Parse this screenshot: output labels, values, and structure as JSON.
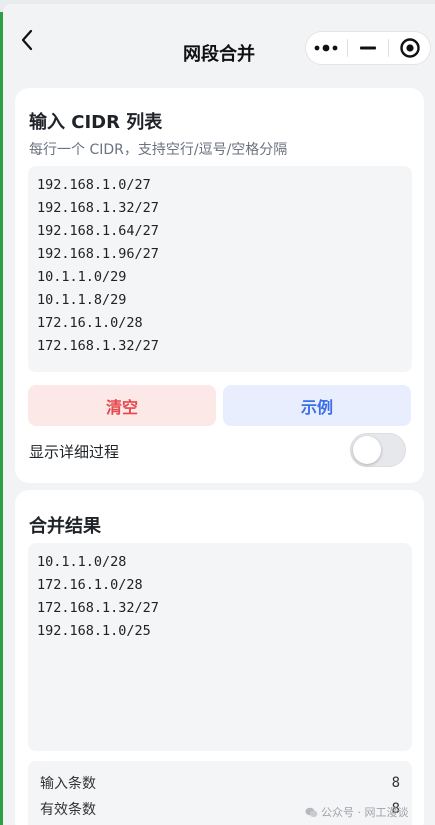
{
  "nav": {
    "title": "网段合并"
  },
  "input_card": {
    "title": "输入 CIDR 列表",
    "subtitle": "每行一个 CIDR，支持空行/逗号/空格分隔",
    "cidrs": [
      "192.168.1.0/27",
      "192.168.1.32/27",
      "192.168.1.64/27",
      "192.168.1.96/27",
      "10.1.1.0/29",
      "10.1.1.8/29",
      "172.16.1.0/28",
      "172.168.1.32/27"
    ],
    "clear_label": "清空",
    "example_label": "示例",
    "toggle_label": "显示详细过程",
    "toggle_on": false
  },
  "result_card": {
    "title": "合并结果",
    "cidrs": [
      "10.1.1.0/28",
      "172.16.1.0/28",
      "172.168.1.32/27",
      "192.168.1.0/25"
    ],
    "stats": [
      {
        "label": "输入条数",
        "value": "8"
      },
      {
        "label": "有效条数",
        "value": "8"
      }
    ]
  },
  "watermark": {
    "text": "公众号 · 网工漫谈"
  },
  "colors": {
    "clear_text": "#e5484d",
    "clear_bg": "#fde8e8",
    "example_text": "#3b6fe8",
    "example_bg": "#e8eefe"
  }
}
